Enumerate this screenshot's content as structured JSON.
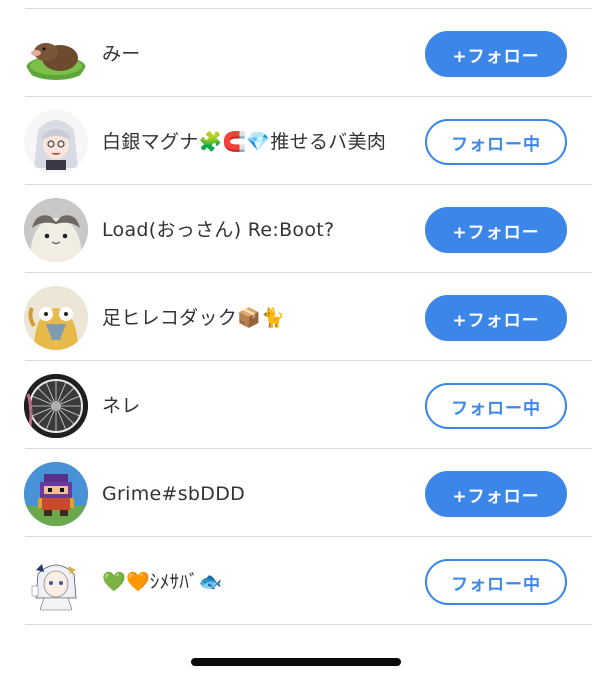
{
  "users": [
    {
      "name": "みー",
      "button": "+フォロー",
      "following": false,
      "avatar": "mole-avatar-icon"
    },
    {
      "name": "白銀マグナ🧩🧲💎推せるバ美肉",
      "button": "フォロー中",
      "following": true,
      "avatar": "silver-hair-girl-avatar-icon"
    },
    {
      "name": "Load(おっさん) Re:Boot?",
      "button": "+フォロー",
      "following": false,
      "avatar": "cat-avatar-icon"
    },
    {
      "name": "足ヒレコダック📦🐈",
      "button": "+フォロー",
      "following": false,
      "avatar": "psyduck-avatar-icon"
    },
    {
      "name": "ネレ",
      "button": "フォロー中",
      "following": true,
      "avatar": "bicycle-wheel-avatar-icon"
    },
    {
      "name": "Grime#sbDDD",
      "button": "+フォロー",
      "following": false,
      "avatar": "pixel-character-avatar-icon"
    },
    {
      "name": "💚🧡ｼﾒｻﾊﾞ🐟",
      "button": "フォロー中",
      "following": true,
      "avatar": "anime-girl-avatar-icon"
    }
  ],
  "colors": {
    "accent": "#3b86e6",
    "text": "#333333",
    "divider": "#d9d9dd"
  }
}
